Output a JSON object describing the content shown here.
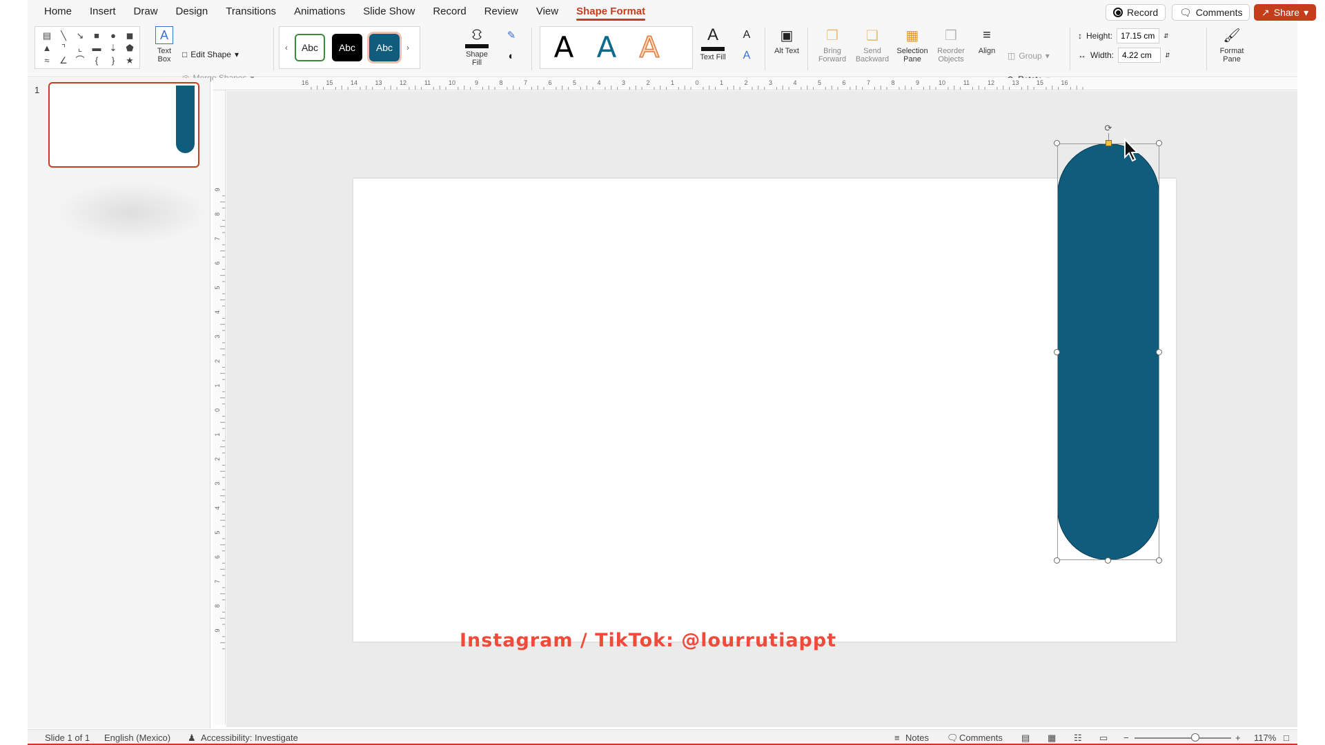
{
  "tabs": [
    "Home",
    "Insert",
    "Draw",
    "Design",
    "Transitions",
    "Animations",
    "Slide Show",
    "Record",
    "Review",
    "View",
    "Shape Format"
  ],
  "active_tab": "Shape Format",
  "top_buttons": {
    "record": "Record",
    "comments": "Comments",
    "share": "Share"
  },
  "ribbon": {
    "text_box": "Text Box",
    "edit_shape": "Edit Shape",
    "merge_shapes": "Merge Shapes",
    "shape_styles": [
      "Abc",
      "Abc",
      "Abc"
    ],
    "shape_fill": "Shape Fill",
    "wordart": [
      "A",
      "A",
      "A"
    ],
    "text_fill": "Text Fill",
    "alt_text": "Alt Text",
    "bring_forward": "Bring Forward",
    "send_backward": "Send Backward",
    "selection_pane": "Selection Pane",
    "reorder_objects": "Reorder Objects",
    "align": "Align",
    "group": "Group",
    "rotate": "Rotate",
    "height_label": "Height:",
    "height_value": "17.15 cm",
    "width_label": "Width:",
    "width_value": "4.22 cm",
    "format_pane": "Format Pane"
  },
  "thumbnails": {
    "slide_number": "1"
  },
  "ruler": {
    "horizontal_ticks": [
      "16",
      "15",
      "14",
      "13",
      "12",
      "11",
      "10",
      "9",
      "8",
      "7",
      "6",
      "5",
      "4",
      "3",
      "2",
      "1",
      "0",
      "1",
      "2",
      "3",
      "4",
      "5",
      "6",
      "7",
      "8",
      "9",
      "10",
      "11",
      "12",
      "13",
      "15",
      "16"
    ],
    "vertical_ticks": [
      "9",
      "8",
      "7",
      "6",
      "5",
      "4",
      "3",
      "2",
      "1",
      "0",
      "1",
      "2",
      "3",
      "4",
      "5",
      "6",
      "7",
      "8",
      "9"
    ]
  },
  "slide": {
    "watermark": "Instagram / TikTok: @lourrutiappt",
    "shape_color": "#0f5c7c"
  },
  "status": {
    "slide_info": "Slide 1 of 1",
    "language": "English (Mexico)",
    "accessibility": "Accessibility: Investigate",
    "notes": "Notes",
    "comments": "Comments",
    "zoom": "117%"
  },
  "colors": {
    "accent": "#c43e1c",
    "shape": "#0f5c7c"
  }
}
